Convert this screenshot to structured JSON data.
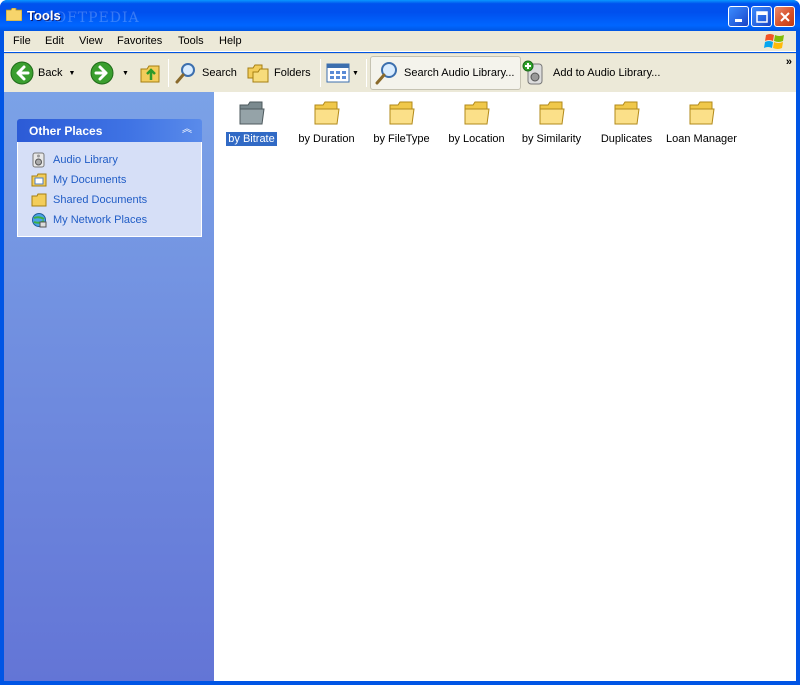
{
  "window": {
    "title": "Tools",
    "watermark": "SOFTPEDIA"
  },
  "menu": {
    "items": [
      "File",
      "Edit",
      "View",
      "Favorites",
      "Tools",
      "Help"
    ]
  },
  "toolbar": {
    "back_label": "Back",
    "search_label": "Search",
    "folders_label": "Folders",
    "search_audio_label": "Search Audio Library...",
    "add_audio_label": "Add to Audio Library...",
    "more_label": "»"
  },
  "taskpane": {
    "title": "Other Places",
    "items": [
      {
        "label": "Audio Library",
        "icon": "audio-library-icon"
      },
      {
        "label": "My Documents",
        "icon": "my-documents-icon"
      },
      {
        "label": "Shared Documents",
        "icon": "shared-documents-icon"
      },
      {
        "label": "My Network Places",
        "icon": "network-places-icon"
      }
    ]
  },
  "folders": [
    {
      "label": "by Bitrate",
      "selected": true
    },
    {
      "label": "by Duration",
      "selected": false
    },
    {
      "label": "by FileType",
      "selected": false
    },
    {
      "label": "by Location",
      "selected": false
    },
    {
      "label": "by Similarity",
      "selected": false
    },
    {
      "label": "Duplicates",
      "selected": false
    },
    {
      "label": "Loan Manager",
      "selected": false
    }
  ],
  "colors": {
    "titlebar": "#0054e3",
    "taskpane_top": "#7ba2e7",
    "taskpane_bottom": "#6375d6",
    "selection": "#316ac5",
    "link": "#215dc6"
  }
}
